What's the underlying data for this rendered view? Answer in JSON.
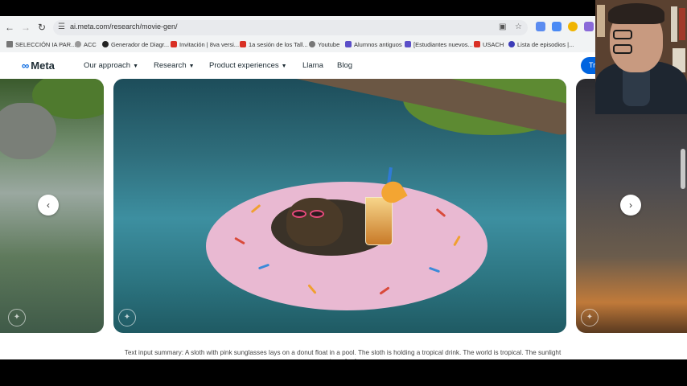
{
  "browser": {
    "url": "ai.meta.com/research/movie-gen/",
    "bookmarks": [
      "SELECCIÓN IA PAR...",
      "ACC",
      "Generador de Diagr...",
      "Invitación | 8va versi...",
      "1a sesión de los Tall...",
      "Youtube",
      "Alumnos antiguos",
      "[Estudiantes nuevos...",
      "USACH",
      "Lista de episodios |..."
    ]
  },
  "site": {
    "logo": "Meta",
    "nav": [
      "Our approach",
      "Research",
      "Product experiences",
      "Llama",
      "Blog"
    ],
    "cta": "Tr"
  },
  "caption": "Text input summary: A sloth with pink sunglasses lays on a donut float in a pool. The sloth is holding a tropical drink. The world is tropical. The sunlight casts a shadow.",
  "colors": {
    "accent": "#0064e0",
    "donut": "#e9b9d2"
  }
}
